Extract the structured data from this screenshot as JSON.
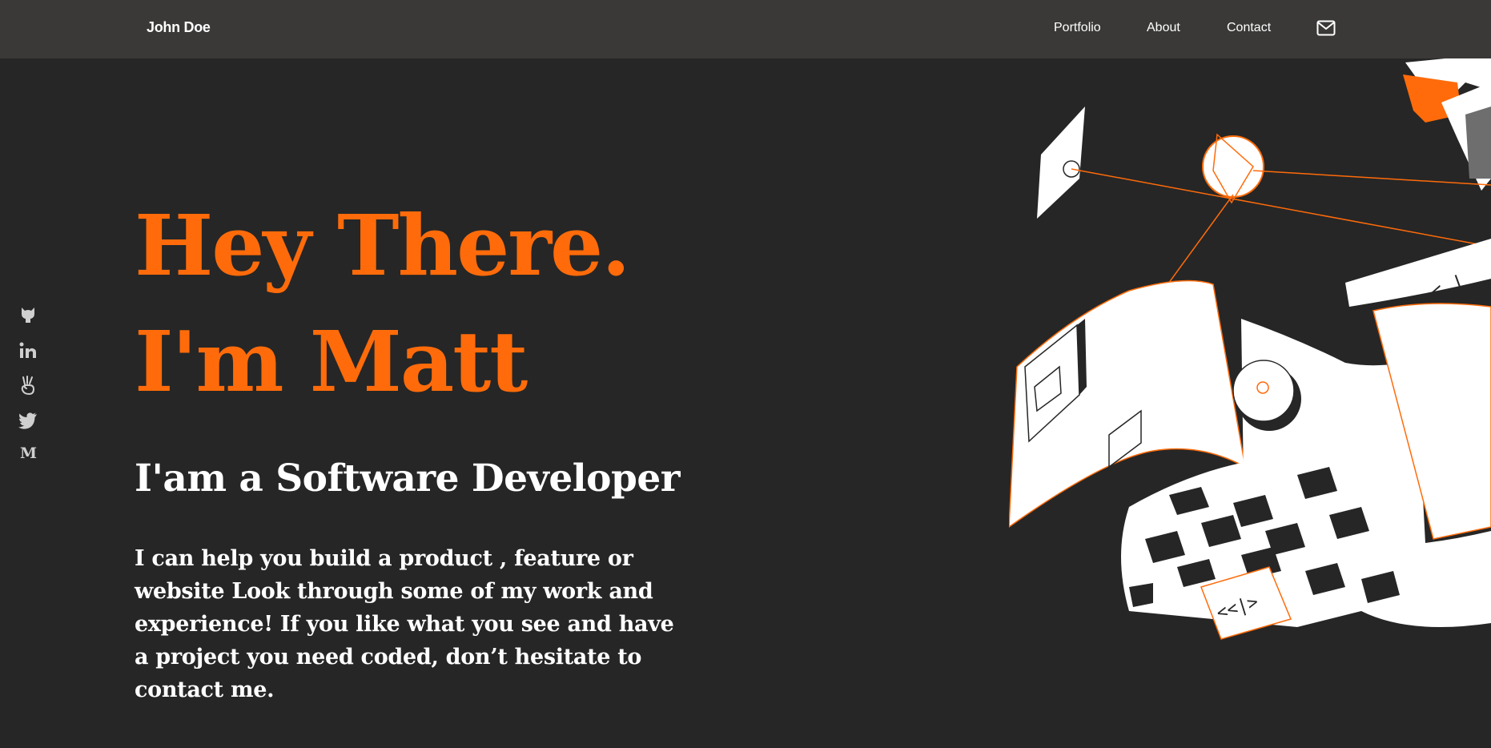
{
  "header": {
    "brand": "John Doe",
    "nav": [
      {
        "label": "Portfolio"
      },
      {
        "label": "About"
      },
      {
        "label": "Contact"
      }
    ],
    "mail_icon": "mail-icon"
  },
  "social": {
    "icons": [
      "github-icon",
      "linkedin-icon",
      "angellist-icon",
      "twitter-icon",
      "medium-icon"
    ],
    "medium_label": "M"
  },
  "hero": {
    "line1": "Hey There.",
    "line2": "I'm Matt",
    "subtitle": "I'am a Software Developer",
    "description": "I can help you build a product , feature or website Look through some of my work and experience! If you like what you see and have a project you need coded, don’t hesitate to contact me."
  },
  "illustration": {
    "code_tag_1": "<_|_",
    "code_tag_2": "<<|>"
  },
  "colors": {
    "accent": "#ff6b0a",
    "background": "#262626",
    "navbar": "#3a3938",
    "text": "#ffffff"
  }
}
